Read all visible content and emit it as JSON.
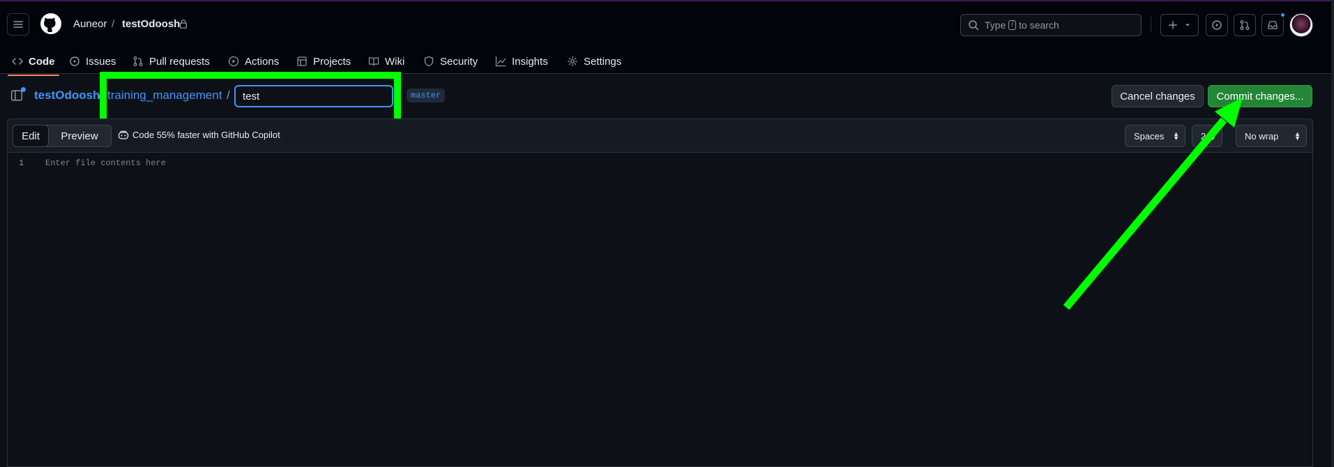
{
  "header": {
    "owner": "Auneor",
    "separator": "/",
    "repo": "testOdoosh",
    "search_placeholder_prefix": "Type",
    "search_key": "/",
    "search_placeholder_suffix": "to search"
  },
  "tabs": [
    {
      "label": "Code",
      "icon": "code-icon",
      "active": true
    },
    {
      "label": "Issues",
      "icon": "issue-icon"
    },
    {
      "label": "Pull requests",
      "icon": "pull-request-icon"
    },
    {
      "label": "Actions",
      "icon": "play-icon"
    },
    {
      "label": "Projects",
      "icon": "table-icon"
    },
    {
      "label": "Wiki",
      "icon": "book-icon"
    },
    {
      "label": "Security",
      "icon": "shield-icon"
    },
    {
      "label": "Insights",
      "icon": "graph-icon"
    },
    {
      "label": "Settings",
      "icon": "gear-icon"
    }
  ],
  "breadcrumb": {
    "repo": "testOdoosh",
    "sep": "/",
    "directory": "training_management",
    "filename_value": "test",
    "branch": "master"
  },
  "actions": {
    "cancel_label": "Cancel changes",
    "commit_label": "Commit changes..."
  },
  "editor": {
    "edit_label": "Edit",
    "preview_label": "Preview",
    "copilot_text": "Code 55% faster with GitHub Copilot",
    "indent_mode": "Spaces",
    "indent_size": "2",
    "wrap_mode": "No wrap",
    "line_number": "1",
    "placeholder": "Enter file contents here"
  },
  "annotations": {
    "highlight_color": "#00ff00"
  }
}
